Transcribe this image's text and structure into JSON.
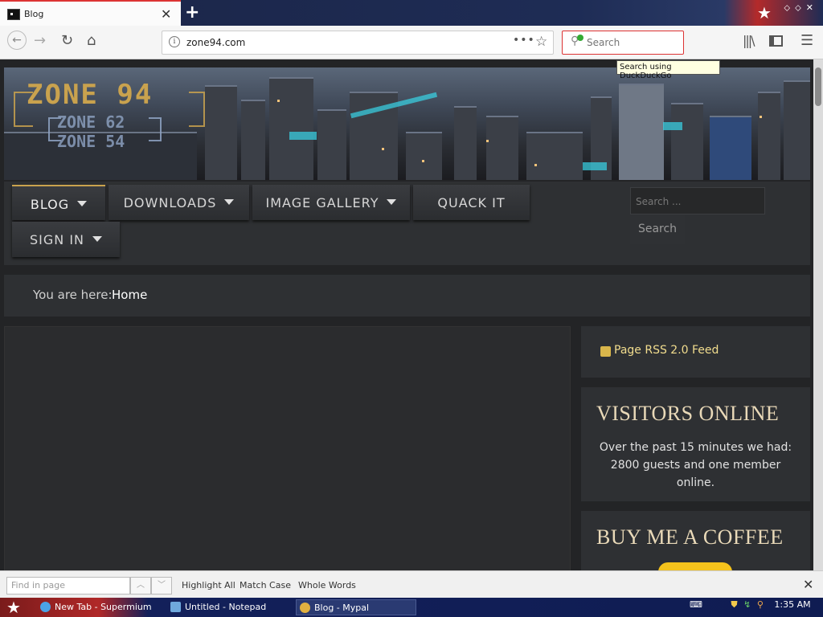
{
  "browser": {
    "tab_title": "Blog",
    "tab_close": "✕",
    "new_tab": "+",
    "url": "zone94.com",
    "search_placeholder": "Search",
    "tooltip": "Search using DuckDuckGo"
  },
  "site": {
    "logo": "ZONE 94",
    "logo_sub1": "ZONE 62",
    "logo_sub2": "ZONE 54",
    "menu": [
      {
        "label": "BLOG",
        "has_dropdown": true
      },
      {
        "label": "DOWNLOADS",
        "has_dropdown": true
      },
      {
        "label": "IMAGE GALLERY",
        "has_dropdown": true
      },
      {
        "label": "QUACK IT",
        "has_dropdown": false
      },
      {
        "label": "SIGN IN",
        "has_dropdown": true
      }
    ],
    "search_placeholder": "Search ...",
    "search_button": "Search",
    "breadcrumb_label": "You are here:",
    "breadcrumb_current": "Home",
    "rss_label": "Page RSS 2.0 Feed",
    "visitors_title": "VISITORS ONLINE",
    "visitors_text": "Over the past 15 minutes we had: 2800 guests and one member online.",
    "coffee_title": "BUY ME A COFFEE",
    "accent_color": "#c9a24e"
  },
  "findbar": {
    "placeholder": "Find in page",
    "highlight_all": "Highlight All",
    "match_case": "Match Case",
    "whole_words": "Whole Words"
  },
  "taskbar": {
    "items": [
      "New Tab - Supermium",
      "Untitled - Notepad",
      "Blog - Mypal"
    ],
    "clock": "1:35 AM"
  }
}
